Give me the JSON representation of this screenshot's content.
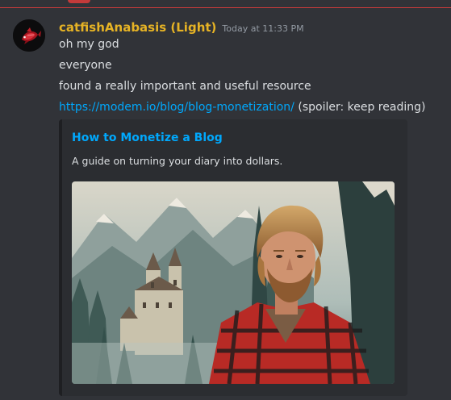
{
  "message": {
    "author": "catfishAnabasis (Light)",
    "timestamp": "Today at 11:33 PM",
    "lines": [
      "oh my god",
      "everyone",
      "found a really important and useful resource"
    ],
    "link": {
      "url_text": "https://modem.io/blog/blog-monetization/",
      "suffix": " (spoiler: keep reading)"
    }
  },
  "embed": {
    "title": "How to Monetize a Blog",
    "description": "A guide on turning your diary into dollars."
  },
  "colors": {
    "username": "#e6b325",
    "link": "#00a8fc",
    "background": "#313338",
    "embed_background": "#2b2d31",
    "new_messages_divider": "#c43a3a"
  }
}
